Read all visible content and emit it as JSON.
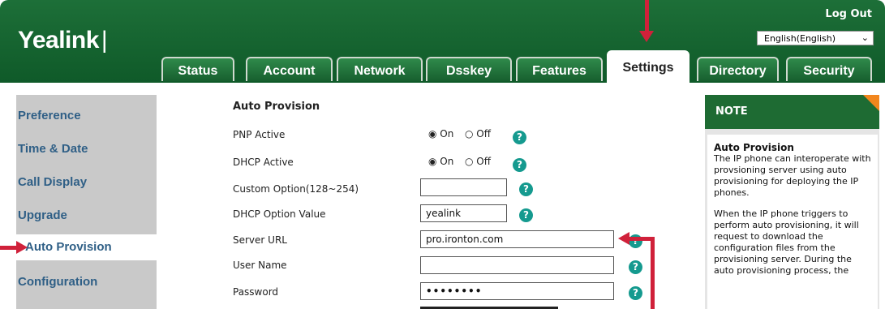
{
  "header": {
    "logo": "Yealink",
    "logout": "Log Out",
    "language": "English(English)"
  },
  "tabs": [
    "Status",
    "Account",
    "Network",
    "Dsskey",
    "Features",
    "Settings",
    "Directory",
    "Security"
  ],
  "active_tab": "Settings",
  "sidebar": {
    "items": [
      "Preference",
      "Time & Date",
      "Call Display",
      "Upgrade",
      "Auto Provision",
      "Configuration"
    ],
    "active": "Auto Provision"
  },
  "form": {
    "title": "Auto Provision",
    "pnp_active_label": "PNP Active",
    "dhcp_active_label": "DHCP Active",
    "on_label": "On",
    "off_label": "Off",
    "custom_option_label": "Custom Option(128~254)",
    "custom_option_value": "",
    "dhcp_option_label": "DHCP Option Value",
    "dhcp_option_value": "yealink",
    "server_url_label": "Server URL",
    "server_url_value": "pro.ironton.com",
    "user_name_label": "User Name",
    "user_name_value": "",
    "password_label": "Password",
    "password_value": "••••••••",
    "help_symbol": "?"
  },
  "note": {
    "header": "NOTE",
    "title": "Auto Provision",
    "para1": "The IP phone can interoperate with provsioning server using auto provisioning for deploying the IP phones.",
    "para2": "When the IP phone triggers to perform auto provisioning, it will request to download the configuration files from the provisioning server. During the auto provisioning process, the"
  },
  "colors": {
    "header_green": "#1d6f38",
    "sidebar_text": "#2f5f86",
    "help_teal": "#159a8f",
    "annotation_red": "#d0213a",
    "note_corner": "#f2861d"
  }
}
